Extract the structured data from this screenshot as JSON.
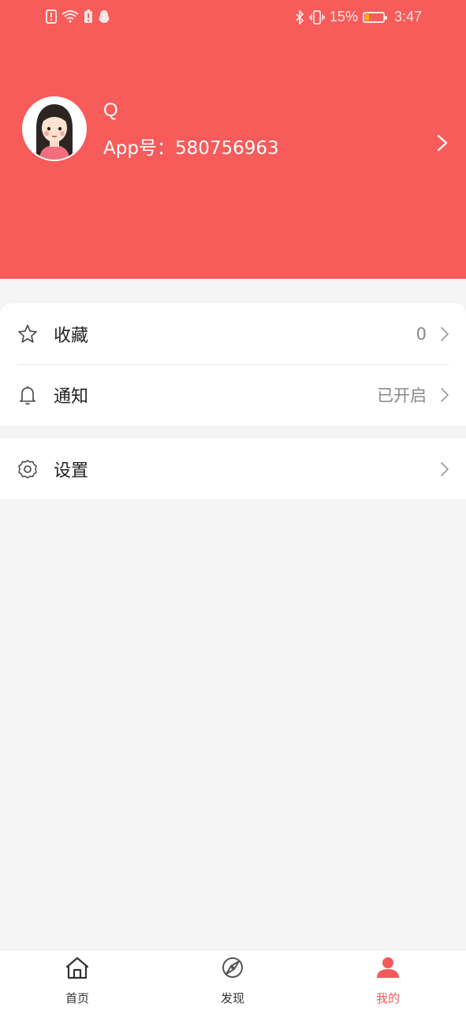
{
  "status_bar": {
    "battery_percent": "15%",
    "time": "3:47"
  },
  "profile": {
    "name": "Q",
    "app_id_label": "App号：",
    "app_id_value": "580756963"
  },
  "menu": {
    "favorites": {
      "label": "收藏",
      "value": "0"
    },
    "notifications": {
      "label": "通知",
      "value": "已开启"
    },
    "settings": {
      "label": "设置"
    }
  },
  "tabs": [
    {
      "label": "首页",
      "icon": "home-icon"
    },
    {
      "label": "发现",
      "icon": "discover-icon"
    },
    {
      "label": "我的",
      "icon": "user-icon",
      "active": true
    }
  ],
  "colors": {
    "brand": "#f75b5a",
    "active_tab": "#f45a5a"
  }
}
